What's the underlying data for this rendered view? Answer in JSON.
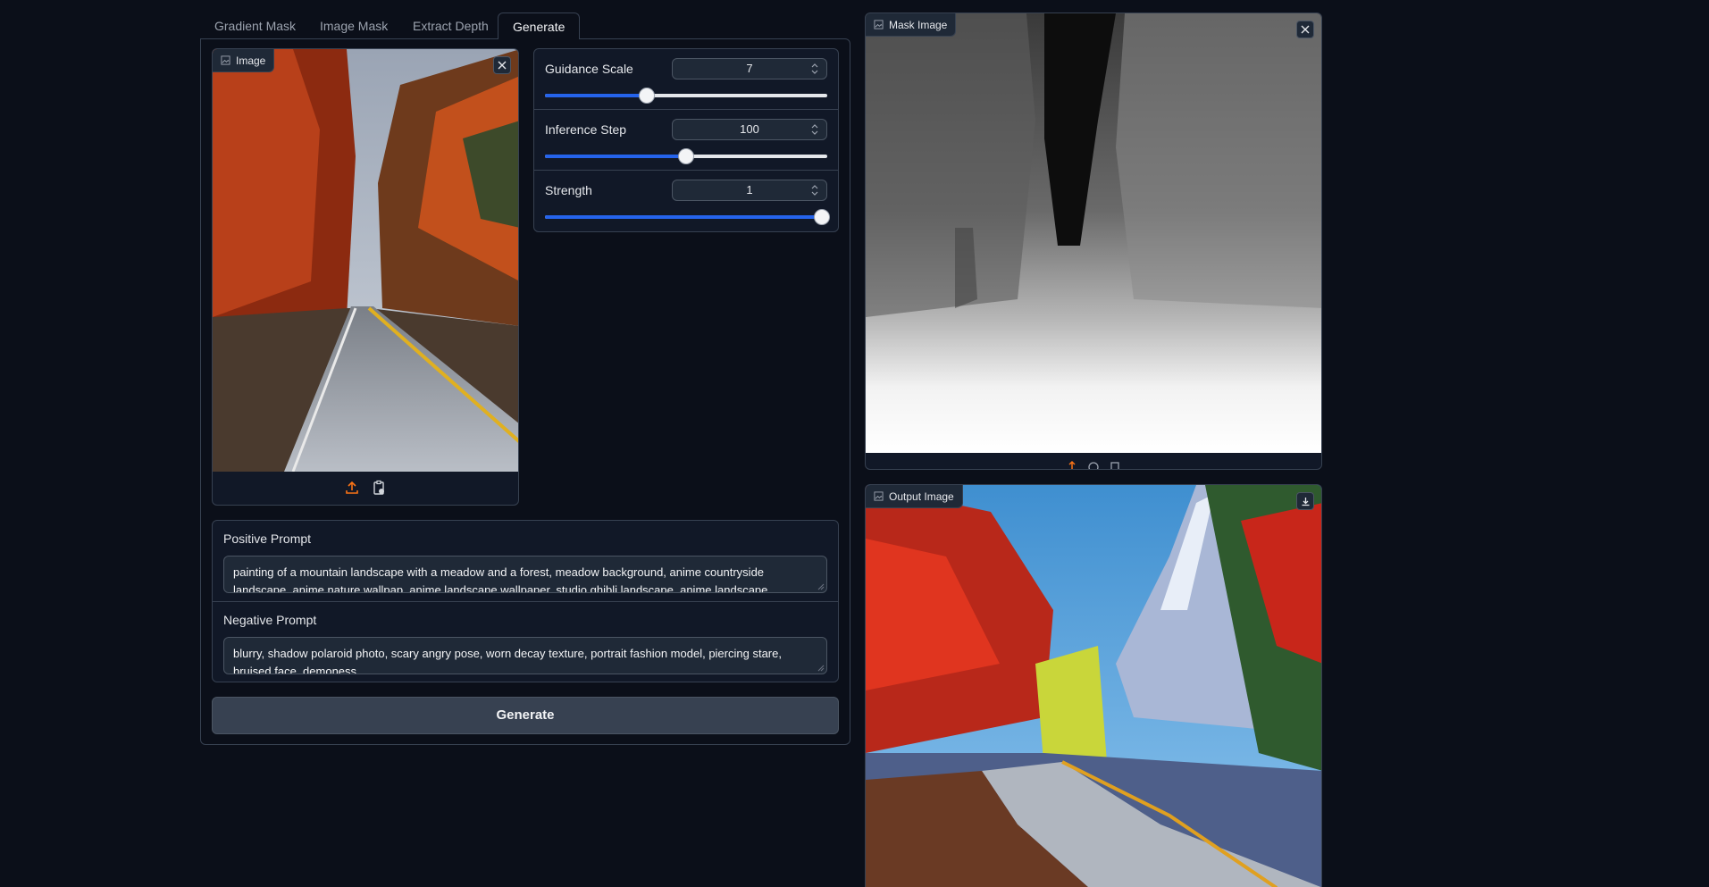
{
  "tabs": [
    {
      "label": "Gradient Mask",
      "active": false
    },
    {
      "label": "Image Mask",
      "active": false
    },
    {
      "label": "Extract Depth",
      "active": false
    },
    {
      "label": "Generate",
      "active": true
    }
  ],
  "input_image": {
    "label": "Image",
    "description": "autumn road with red trees"
  },
  "sliders": [
    {
      "label": "Guidance Scale",
      "value": "7",
      "fraction": 0.36
    },
    {
      "label": "Inference Step",
      "value": "100",
      "fraction": 0.5
    },
    {
      "label": "Strength",
      "value": "1",
      "fraction": 0.98
    }
  ],
  "positive_prompt": {
    "label": "Positive Prompt",
    "value": "painting of a mountain landscape with a meadow and a forest, meadow background, anime countryside landscape, anime nature wallpap, anime landscape wallpaper, studio ghibli landscape, anime landscape"
  },
  "negative_prompt": {
    "label": "Negative Prompt",
    "value": "blurry, shadow polaroid photo, scary angry pose, worn decay texture, portrait fashion model, piercing stare, bruised face, demoness"
  },
  "generate_button": "Generate",
  "mask_image": {
    "label": "Mask Image"
  },
  "output_image": {
    "label": "Output Image"
  },
  "colors": {
    "accent": "#2563eb",
    "background": "#0b0f19",
    "panel": "#111827",
    "upload_orange": "#f97316"
  }
}
